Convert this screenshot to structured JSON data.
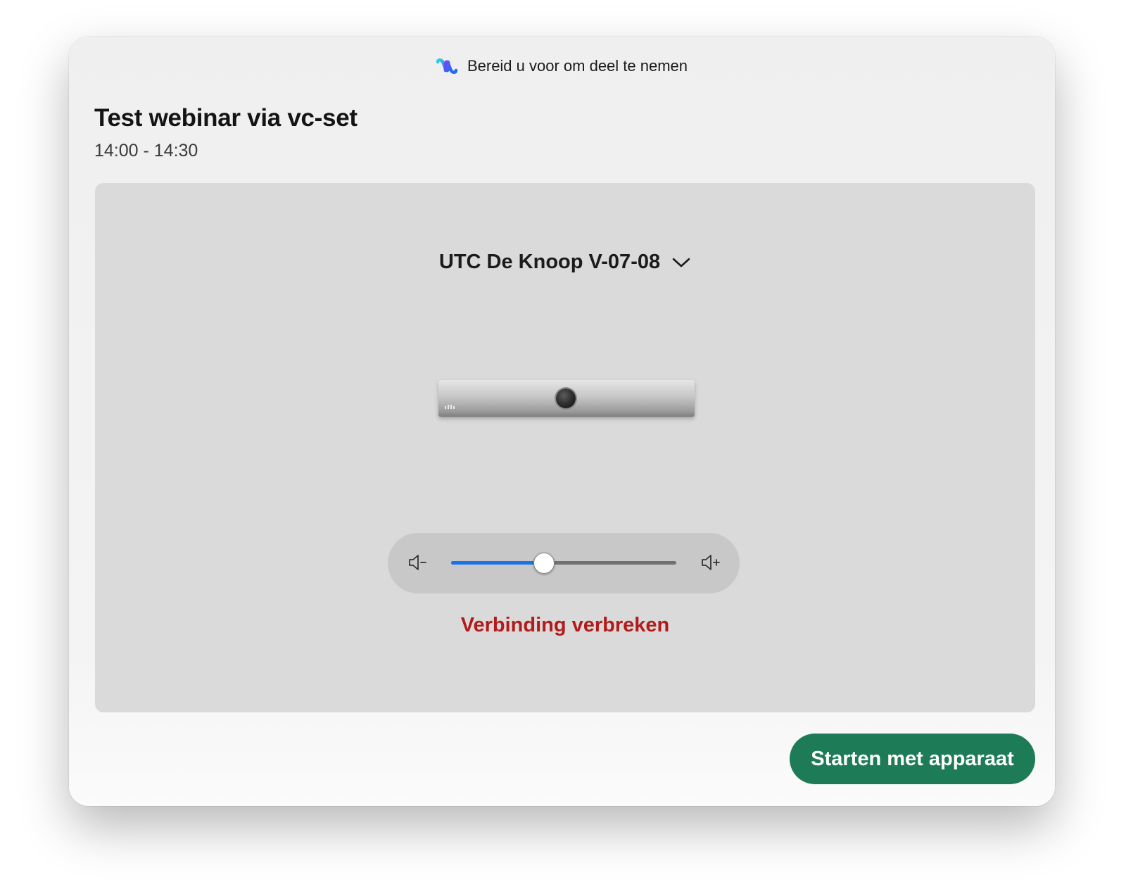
{
  "window": {
    "title": "Bereid u voor om deel te nemen",
    "logo_icon": "webex-logo-icon"
  },
  "meeting": {
    "title": "Test webinar via vc-set",
    "time": "14:00 - 14:30"
  },
  "device": {
    "name": "UTC De Knoop V-07-08",
    "dropdown_icon": "chevron-down-icon",
    "image": "video-bar-device-image"
  },
  "volume": {
    "level_percent": 41,
    "down_icon": "volume-down-icon",
    "up_icon": "volume-up-icon"
  },
  "actions": {
    "disconnect_label": "Verbinding verbreken",
    "start_label": "Starten met apparaat"
  },
  "colors": {
    "accent_blue": "#1a73e8",
    "disconnect_red": "#b31b1b",
    "primary_green": "#1e7b58",
    "panel_gray": "#dadada"
  }
}
